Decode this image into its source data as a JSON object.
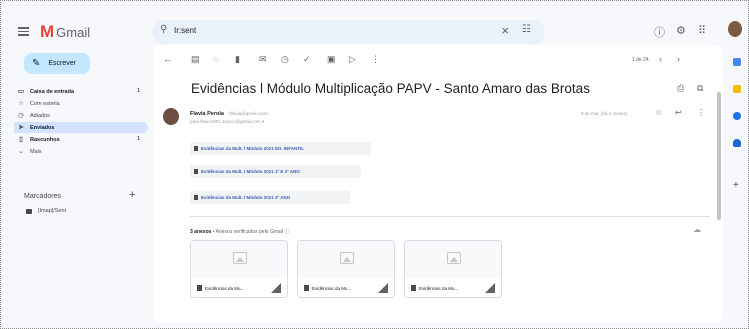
{
  "app": {
    "logo_mark": "M",
    "logo_text": "Gmail"
  },
  "search": {
    "value": "Ir:sent",
    "search_icon": "search-icon",
    "clear_icon": "close-icon",
    "tune_icon": "tune-icon"
  },
  "header_icons": [
    "help-icon",
    "settings-icon",
    "apps-icon"
  ],
  "sidebar": {
    "compose_label": "Escrever",
    "items": [
      {
        "label": "Caixa de entrada",
        "count": "1",
        "icon": "inbox-icon",
        "bold": true
      },
      {
        "label": "Com estrela",
        "count": "",
        "icon": "star-icon",
        "bold": false
      },
      {
        "label": "Adiados",
        "count": "",
        "icon": "clock-icon",
        "bold": false
      },
      {
        "label": "Enviados",
        "count": "",
        "icon": "send-icon",
        "bold": true,
        "active": true
      },
      {
        "label": "Rascunhos",
        "count": "1",
        "icon": "draft-icon",
        "bold": true
      },
      {
        "label": "Mais",
        "count": "",
        "icon": "chevron-down-icon",
        "bold": false
      }
    ],
    "labels_header": "Marcadores",
    "labels": [
      {
        "label": "[Imap]/Sent"
      }
    ]
  },
  "toolbar": {
    "pager_text": "1 de 24",
    "icons": [
      "back-icon",
      "archive-icon",
      "report-icon",
      "delete-icon",
      "mark-unread-icon",
      "snooze-icon",
      "add-task-icon",
      "move-icon",
      "label-icon",
      "more-icon"
    ]
  },
  "message": {
    "subject": "Evidências l Módulo Multiplicação PAPV - Santo Amaro das Brotas",
    "sender_name": "Flavia Perola",
    "sender_email": "<flavia@gmail.com>",
    "to": "para flavio1001.ampvo@gmail.com ▾",
    "time": "9 de mar. (há 2 meses)",
    "links": [
      "Evidências da Mult. l Módulo 2021 ED. INFANTIL",
      "Evidências da Mult. l Módulo 2021 1º E 2º ANO",
      "Evidências da Mult. l Módulo 2021 3º ANO"
    ]
  },
  "attachments": {
    "count_label": "3 anexos",
    "note": " • Anexos verificados pelo Gmail ⓘ",
    "files": [
      {
        "name": "Evidências da Mu..."
      },
      {
        "name": "Evidências da Mu..."
      },
      {
        "name": "Evidências da Mu..."
      }
    ]
  },
  "colors": {
    "accent": "#c2e7ff",
    "active_nav": "#d3e3fd",
    "logo_red": "#ea4335",
    "link_blue": "#3c5fb4"
  }
}
